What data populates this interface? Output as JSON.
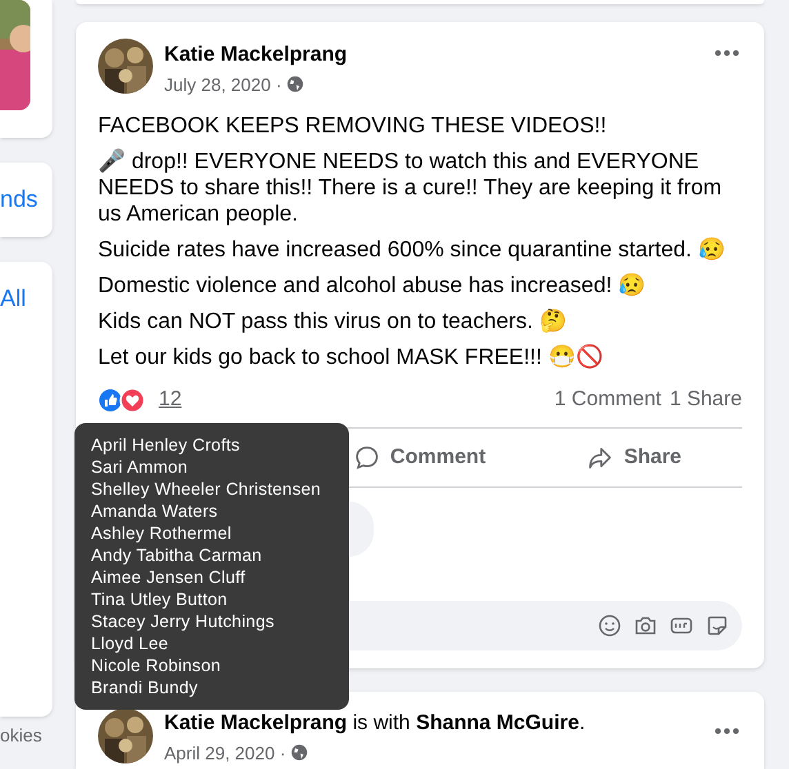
{
  "sidebar": {
    "cards": [
      {
        "kind": "picture"
      },
      {
        "kind": "link",
        "text": "nds"
      },
      {
        "kind": "link",
        "text": "All"
      }
    ],
    "footer": "okies"
  },
  "post": {
    "author": "Katie Mackelprang",
    "date": "July 28, 2020 ·",
    "paragraphs": [
      "FACEBOOK KEEPS REMOVING THESE VIDEOS!!",
      "🎤 drop!! EVERYONE NEEDS to watch this and EVERYONE NEEDS to share this!! There is a cure!! They are keeping it from us American people.",
      "Suicide rates have increased 600% since quarantine started. 😥",
      "Domestic violence and alcohol abuse has increased! 😥",
      "Kids can NOT pass this virus on to teachers. 🤔",
      "Let our kids go back to school MASK FREE!!! 😷🚫"
    ],
    "reaction_count": "12",
    "comments_count": "1 Comment",
    "shares_count": "1 Share",
    "actions": [
      {
        "kind": "comment",
        "label": "Comment"
      },
      {
        "kind": "share",
        "label": "Share"
      }
    ],
    "comment_field": {
      "kind": "field"
    }
  },
  "tooltip": {
    "names": [
      "April Henley Crofts",
      "Sari Ammon",
      "Shelley Wheeler Christensen",
      "Amanda Waters",
      "Ashley Rothermel",
      "Andy Tabitha Carman",
      "Aimee Jensen Cluff",
      "Tina Utley Button",
      "Stacey Jerry Hutchings",
      "Lloyd Lee",
      "Nicole Robinson",
      "Brandi Bundy"
    ]
  },
  "next_post": {
    "author": "Katie Mackelprang",
    "with_text": "is with",
    "tagged": "Shanna McGuire",
    "end": ".",
    "date": "April 29, 2020 ·"
  }
}
